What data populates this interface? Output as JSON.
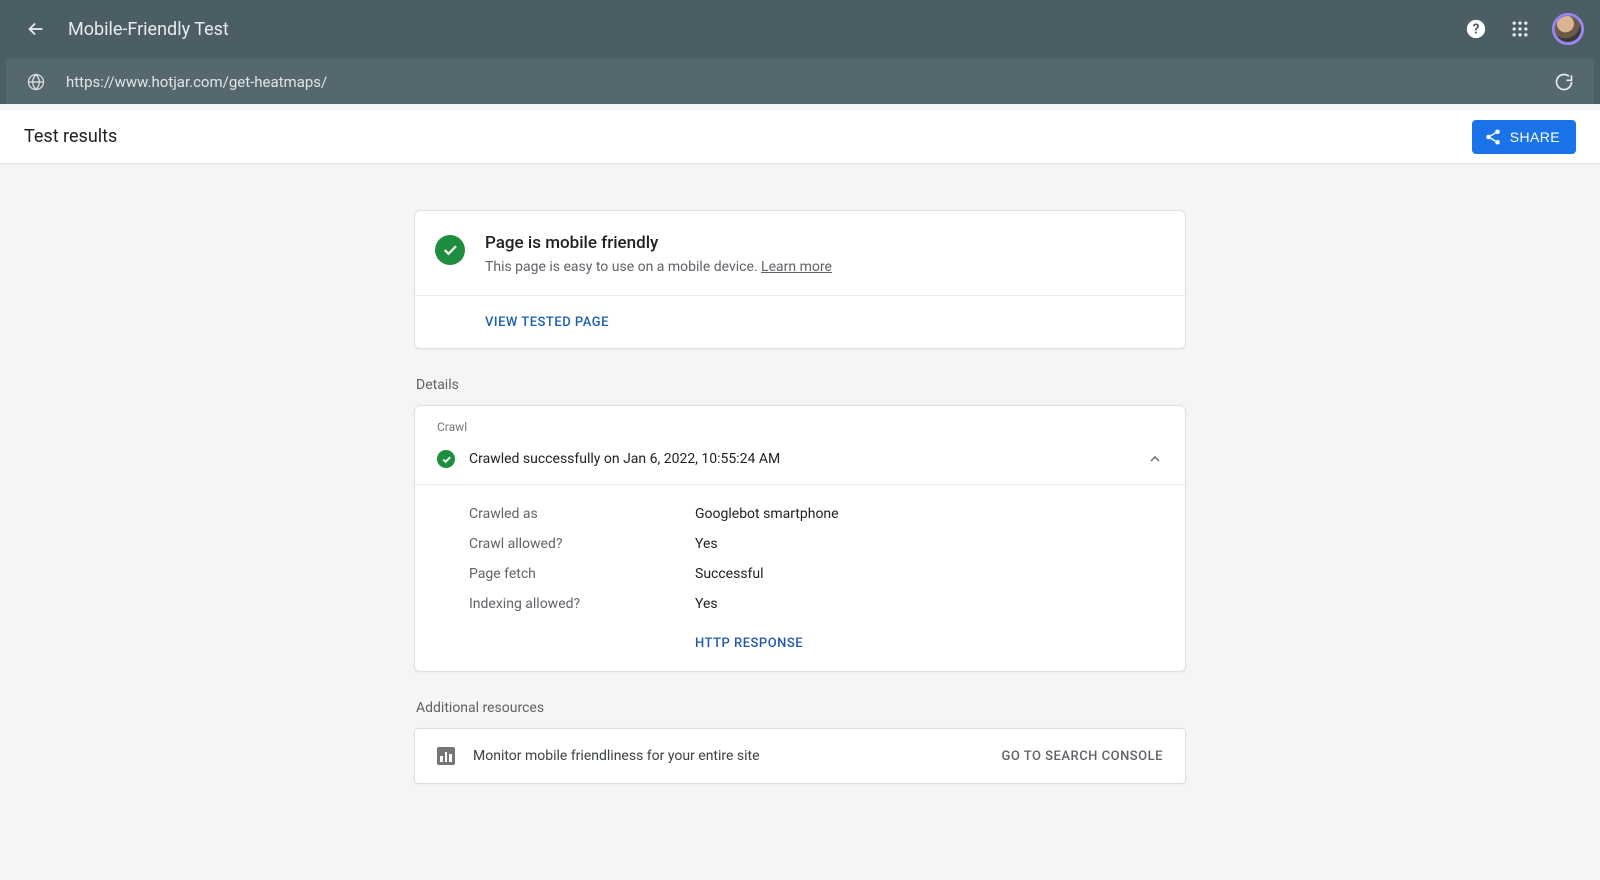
{
  "header": {
    "app_title": "Mobile-Friendly Test"
  },
  "urlbar": {
    "url": "https://www.hotjar.com/get-heatmaps/"
  },
  "subheader": {
    "title": "Test results",
    "share_label": "SHARE"
  },
  "result": {
    "title": "Page is mobile friendly",
    "subtitle_prefix": "This page is easy to use on a mobile device. ",
    "learn_more": "Learn more",
    "view_tested_label": "VIEW TESTED PAGE"
  },
  "details": {
    "section_label": "Details",
    "crawl_label": "Crawl",
    "summary": "Crawled successfully on Jan 6, 2022, 10:55:24 AM",
    "rows": [
      {
        "key": "Crawled as",
        "value": "Googlebot smartphone"
      },
      {
        "key": "Crawl allowed?",
        "value": "Yes"
      },
      {
        "key": "Page fetch",
        "value": "Successful"
      },
      {
        "key": "Indexing allowed?",
        "value": "Yes"
      }
    ],
    "http_response_label": "HTTP RESPONSE"
  },
  "additional": {
    "section_label": "Additional resources",
    "text": "Monitor mobile friendliness for your entire site",
    "cta": "GO TO SEARCH CONSOLE"
  }
}
